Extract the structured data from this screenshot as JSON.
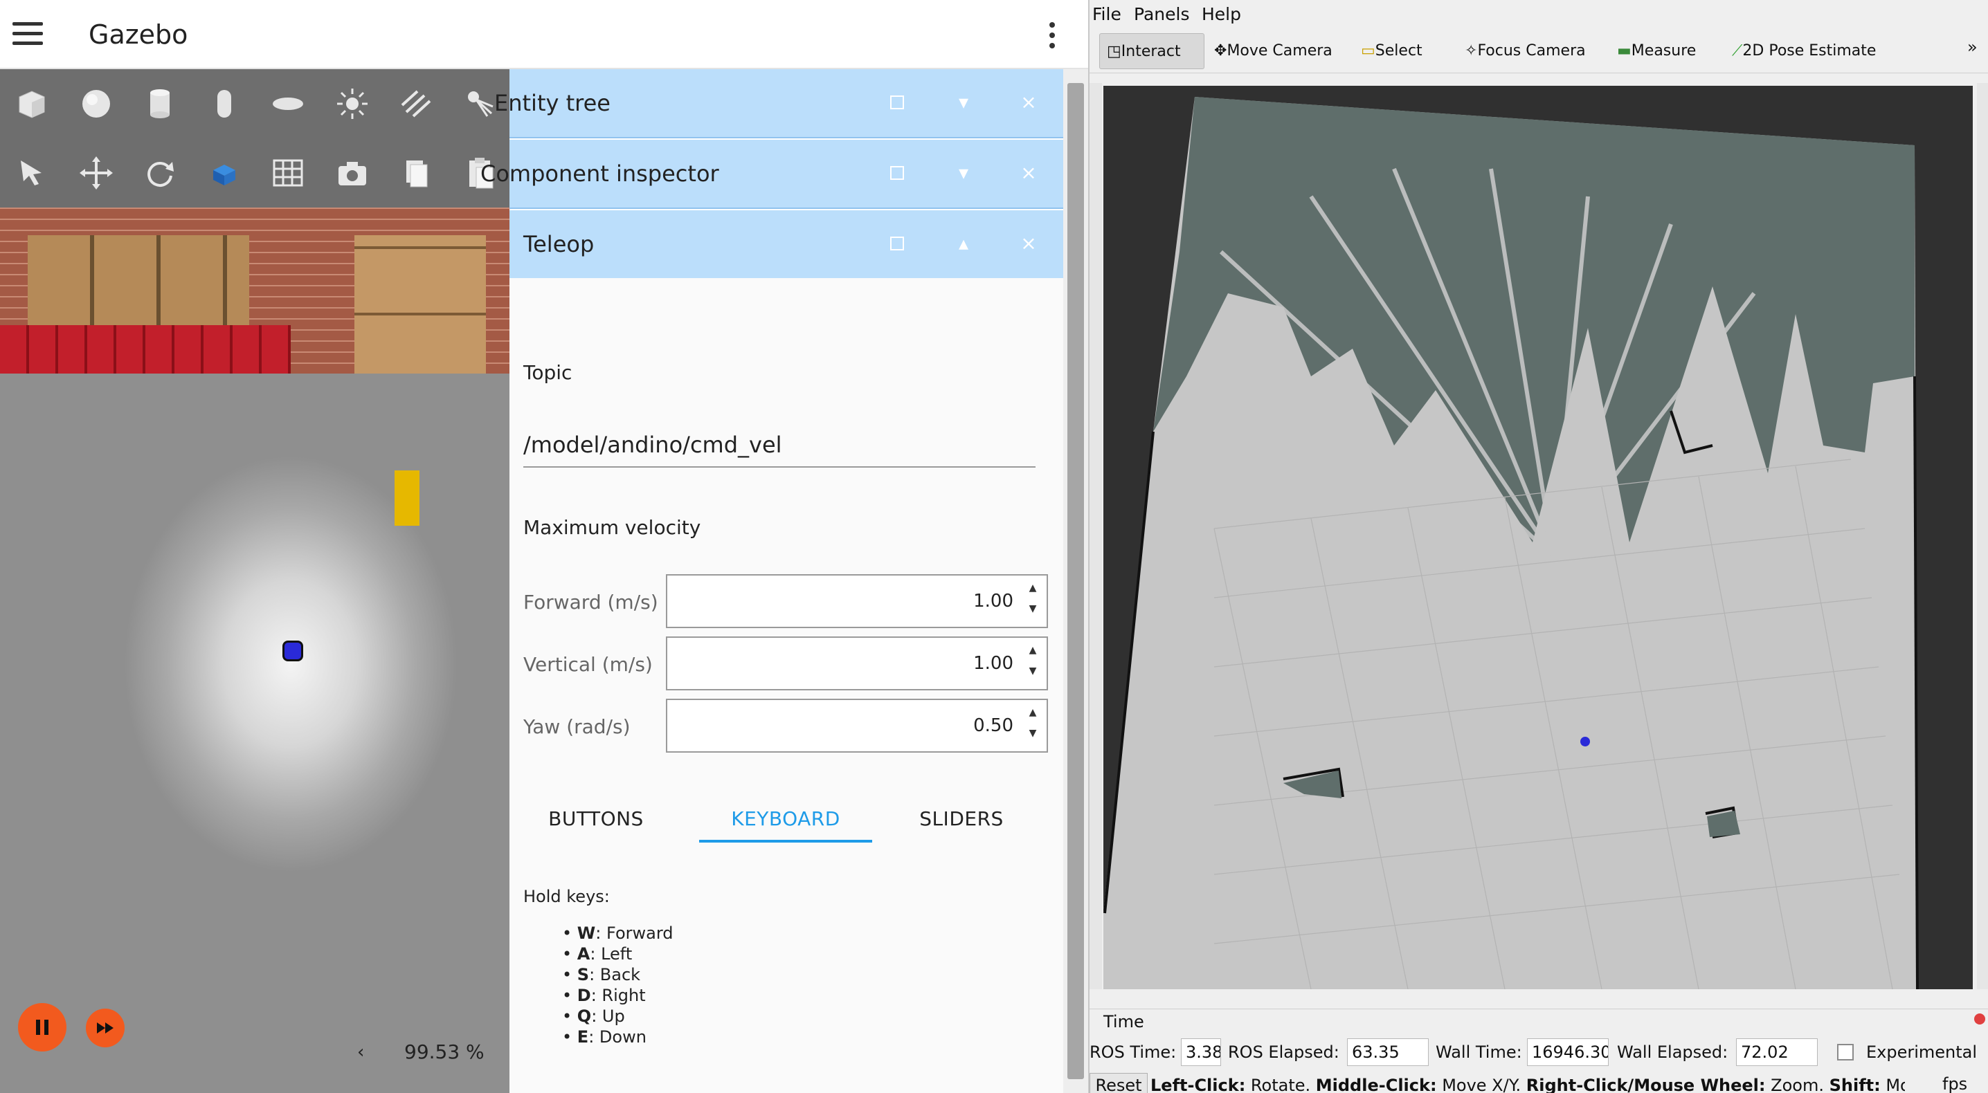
{
  "gazebo": {
    "title": "Gazebo",
    "rtf": "99.53 %",
    "rtf_arrow": "‹",
    "toolbar_row1": [
      "box-icon",
      "sphere-icon",
      "cylinder-icon",
      "capsule-icon",
      "ellipsoid-icon",
      "sun-light-icon",
      "directional-light-icon",
      "spot-light-icon"
    ],
    "toolbar_row2": [
      "select-arrow-icon",
      "translate-icon",
      "rotate-icon",
      "view-angle-icon",
      "grid-icon",
      "camera-icon",
      "copy-icon",
      "paste-icon"
    ],
    "dock": {
      "entity_tree": "Entity tree",
      "component_inspector": "Component inspector",
      "teleop": "Teleop",
      "arrow_down": "▾",
      "arrow_up": "▴",
      "close": "×"
    },
    "teleop": {
      "topic_label": "Topic",
      "topic_value": "/model/andino/cmd_vel",
      "max_velocity_label": "Maximum velocity",
      "forward_label": "Forward (m/s)",
      "forward_value": "1.00",
      "vertical_label": "Vertical (m/s)",
      "vertical_value": "1.00",
      "yaw_label": "Yaw (rad/s)",
      "yaw_value": "0.50",
      "tabs": [
        "BUTTONS",
        "KEYBOARD",
        "SLIDERS"
      ],
      "active_tab": "KEYBOARD",
      "hold_keys_label": "Hold keys:",
      "keys": [
        {
          "key": "W",
          "action": ": Forward"
        },
        {
          "key": "A",
          "action": ": Left"
        },
        {
          "key": "S",
          "action": ": Back"
        },
        {
          "key": "D",
          "action": ": Right"
        },
        {
          "key": "Q",
          "action": ": Up"
        },
        {
          "key": "E",
          "action": ": Down"
        }
      ]
    }
  },
  "rviz": {
    "menu": [
      "File",
      "Panels",
      "Help"
    ],
    "tools": [
      "Interact",
      "Move Camera",
      "Select",
      "Focus Camera",
      "Measure",
      "2D Pose Estimate"
    ],
    "active_tool": "Interact",
    "overflow": "»",
    "time_panel": {
      "title": "Time",
      "ros_time_label": "ROS Time:",
      "ros_time_value": "3.38",
      "ros_elapsed_label": "ROS Elapsed:",
      "ros_elapsed_value": "63.35",
      "wall_time_label": "Wall Time:",
      "wall_time_value": "16946.30",
      "wall_elapsed_label": "Wall Elapsed:",
      "wall_elapsed_value": "72.02",
      "experimental_label": "Experimental",
      "reset_label": "Reset",
      "hint_segments": [
        {
          "bold": "Left-Click:",
          "text": " Rotate. "
        },
        {
          "bold": "Middle-Click:",
          "text": " Move X/Y. "
        },
        {
          "bold": "Right-Click/Mouse Wheel:",
          "text": " Zoom. "
        },
        {
          "bold": "Shift:",
          "text": " More c"
        }
      ],
      "fps_label": "fps"
    }
  },
  "colors": {
    "dock_header": "#bbdefb",
    "active_tab": "#1e9be8",
    "play_controls": "#f25a1e",
    "map_unknown": "#5f6e6b",
    "map_free": "#c8c8c8",
    "map_occupied": "#111111",
    "robot": "#2a2ad8"
  }
}
